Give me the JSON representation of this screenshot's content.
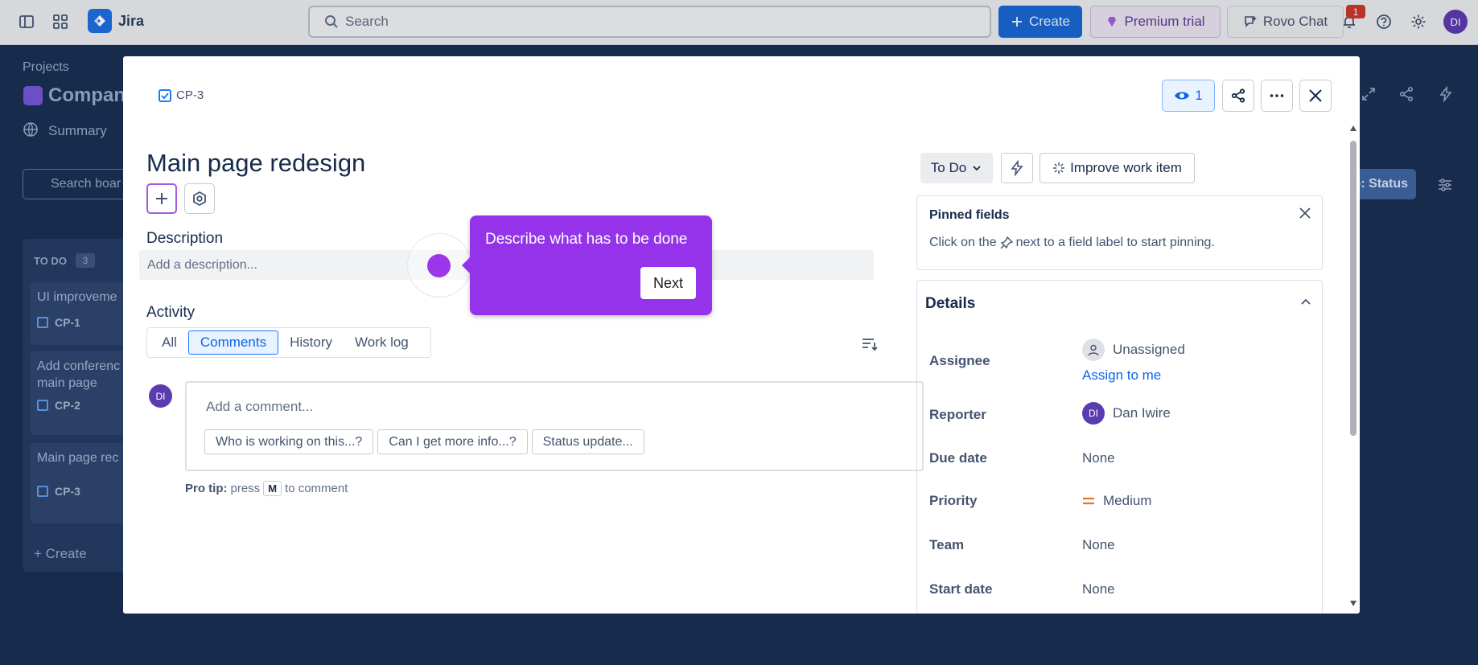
{
  "topnav": {
    "app_name": "Jira",
    "search_placeholder": "Search",
    "create_label": "Create",
    "premium_label": "Premium trial",
    "rovo_label": "Rovo Chat",
    "notification_count": "1",
    "avatar_initials": "DI"
  },
  "background": {
    "breadcrumb": "Projects",
    "project_title": "Compan",
    "summary_tab": "Summary",
    "search_placeholder": "Search boar",
    "column_title": "TO DO",
    "column_count": "3",
    "cards": [
      {
        "title": "UI improveme",
        "key": "CP-1"
      },
      {
        "title": "Add conferenc",
        "title2": "main page",
        "key": "CP-2"
      },
      {
        "title": "Main page rec",
        "key": "CP-3"
      }
    ],
    "create_label": "Create",
    "group_status_label": "p: Status"
  },
  "issue": {
    "key": "CP-3",
    "watchers": "1",
    "title": "Main page redesign",
    "description_label": "Description",
    "description_placeholder": "Add a description...",
    "activity_label": "Activity",
    "tabs": [
      {
        "label": "All",
        "active": false
      },
      {
        "label": "Comments",
        "active": true
      },
      {
        "label": "History",
        "active": false
      },
      {
        "label": "Work log",
        "active": false
      }
    ],
    "comment_avatar": "DI",
    "comment_placeholder": "Add a comment...",
    "quick_replies": [
      "Who is working on this...?",
      "Can I get more info...?",
      "Status update..."
    ],
    "protip_bold": "Pro tip:",
    "protip_press": "press",
    "protip_key": "M",
    "protip_suffix": "to comment"
  },
  "tour": {
    "text": "Describe what has to be done",
    "next_label": "Next"
  },
  "sidebar": {
    "status": "To Do",
    "improve_label": "Improve work item",
    "pinned_title": "Pinned fields",
    "pinned_text_before": "Click on the",
    "pinned_text_after": "next to a field label to start pinning.",
    "details_title": "Details",
    "fields": {
      "assignee_label": "Assignee",
      "assignee_value": "Unassigned",
      "assign_to_me": "Assign to me",
      "reporter_label": "Reporter",
      "reporter_initials": "DI",
      "reporter_value": "Dan Iwire",
      "due_label": "Due date",
      "due_value": "None",
      "priority_label": "Priority",
      "priority_value": "Medium",
      "team_label": "Team",
      "team_value": "None",
      "start_label": "Start date",
      "start_value": "None"
    }
  },
  "colors": {
    "brand": "#1966d2",
    "tour": "#9433ea",
    "priority_medium": "#e2762c"
  }
}
